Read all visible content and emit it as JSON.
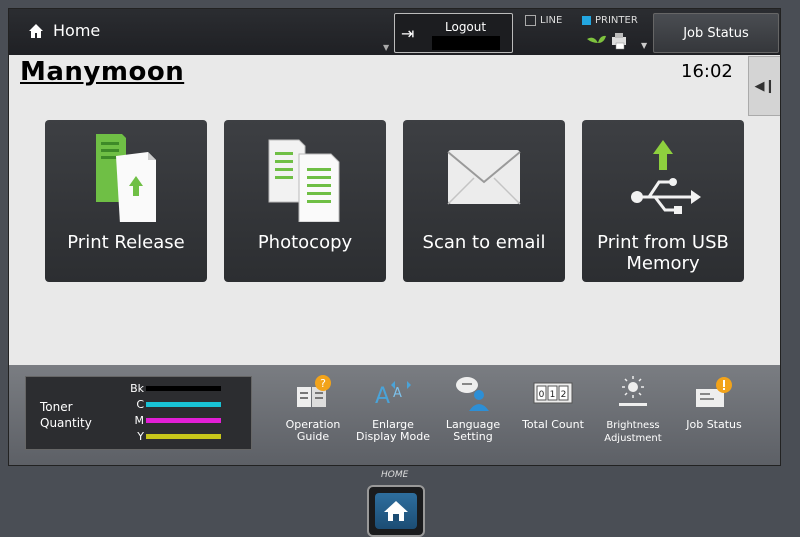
{
  "topbar": {
    "home_label": "Home",
    "logout_label": "Logout",
    "line_label": "LINE",
    "printer_label": "PRINTER",
    "job_status_label": "Job Status"
  },
  "header": {
    "brand": "Manymoon",
    "time": "16:02"
  },
  "tiles": [
    {
      "label": "Print Release",
      "icon": "print-release-icon"
    },
    {
      "label": "Photocopy",
      "icon": "photocopy-icon"
    },
    {
      "label": "Scan to email",
      "icon": "scan-email-icon"
    },
    {
      "label": "Print from USB Memory",
      "icon": "usb-print-icon"
    }
  ],
  "toner": {
    "label": "Toner Quantity",
    "channels": [
      {
        "name": "Bk",
        "color": "#000000"
      },
      {
        "name": "C",
        "color": "#19c3d6"
      },
      {
        "name": "M",
        "color": "#e21fd6"
      },
      {
        "name": "Y",
        "color": "#c7c61a"
      }
    ]
  },
  "tray": [
    {
      "label": "Operation Guide",
      "icon": "operation-guide-icon"
    },
    {
      "label": "Enlarge Display Mode",
      "icon": "enlarge-display-icon"
    },
    {
      "label": "Language Setting",
      "icon": "language-setting-icon"
    },
    {
      "label": "Total Count",
      "icon": "total-count-icon"
    },
    {
      "label": "Brightness Adjustment",
      "icon": "brightness-icon"
    },
    {
      "label": "Job Status",
      "icon": "job-status-icon"
    }
  ],
  "physical_home_label": "HOME"
}
